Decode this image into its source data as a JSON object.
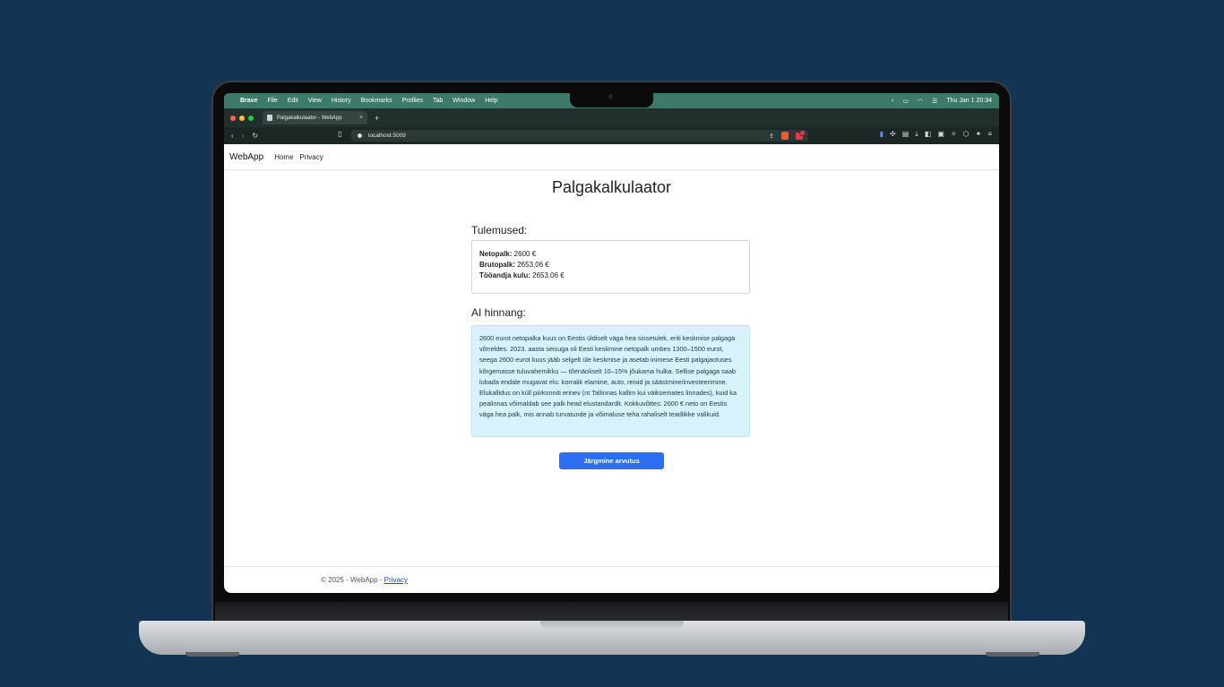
{
  "menubar": {
    "app": "Brave",
    "items": [
      "File",
      "Edit",
      "View",
      "History",
      "Bookmarks",
      "Profiles",
      "Tab",
      "Window",
      "Help"
    ],
    "clock": "Thu Jan 1  20:34"
  },
  "browser": {
    "tab_title": "Palgakalkulaator - WebApp",
    "url": "localhost:5009",
    "accent_color": "#3e7a6b"
  },
  "navbar": {
    "brand": "WebApp",
    "links": [
      "Home",
      "Privacy"
    ]
  },
  "page": {
    "title": "Palgakalkulaator",
    "results_heading": "Tulemused:",
    "results": [
      {
        "label": "Netopalk:",
        "value": " 2600 €"
      },
      {
        "label": "Brutopalk:",
        "value": " 2653,06 €"
      },
      {
        "label": "Tööandja kulu:",
        "value": " 2653,06 €"
      }
    ],
    "ai_heading": "AI hinnang:",
    "ai_text": "2600 eurot netopalka kuus on Eestis üldiselt väga hea sissetulek, eriti keskmise palgaga võrreldes. 2023. aasta seisuga oli Eesti keskmine netopalk umbes 1300–1500 eurot, seega 2600 eurot kuus jääb selgelt üle keskmise ja asetab inimese Eesti palgajaotuses kõrgemasse tuluvahemikku — tõenäoliselt 10–15% jõukama hulka. Sellise palgaga saab lubada endale mugavat elu: korralik elamine, auto, reisid ja säästmine/investeerimine. Elukallidus on küll piirkonniti erinev (nt Tallinnas kallim kui väiksemates linnades), kuid ka pealinnas võimaldab see palk head elustandardit. Kokkuvõttes: 2600 € neto on Eestis väga hea palk, mis annab turvatunde ja võimaluse teha rahaliselt teadlikke valikuid.",
    "next_button": "Järgmine arvutus"
  },
  "footer": {
    "text": "© 2025 - WebApp - ",
    "link": "Privacy"
  }
}
